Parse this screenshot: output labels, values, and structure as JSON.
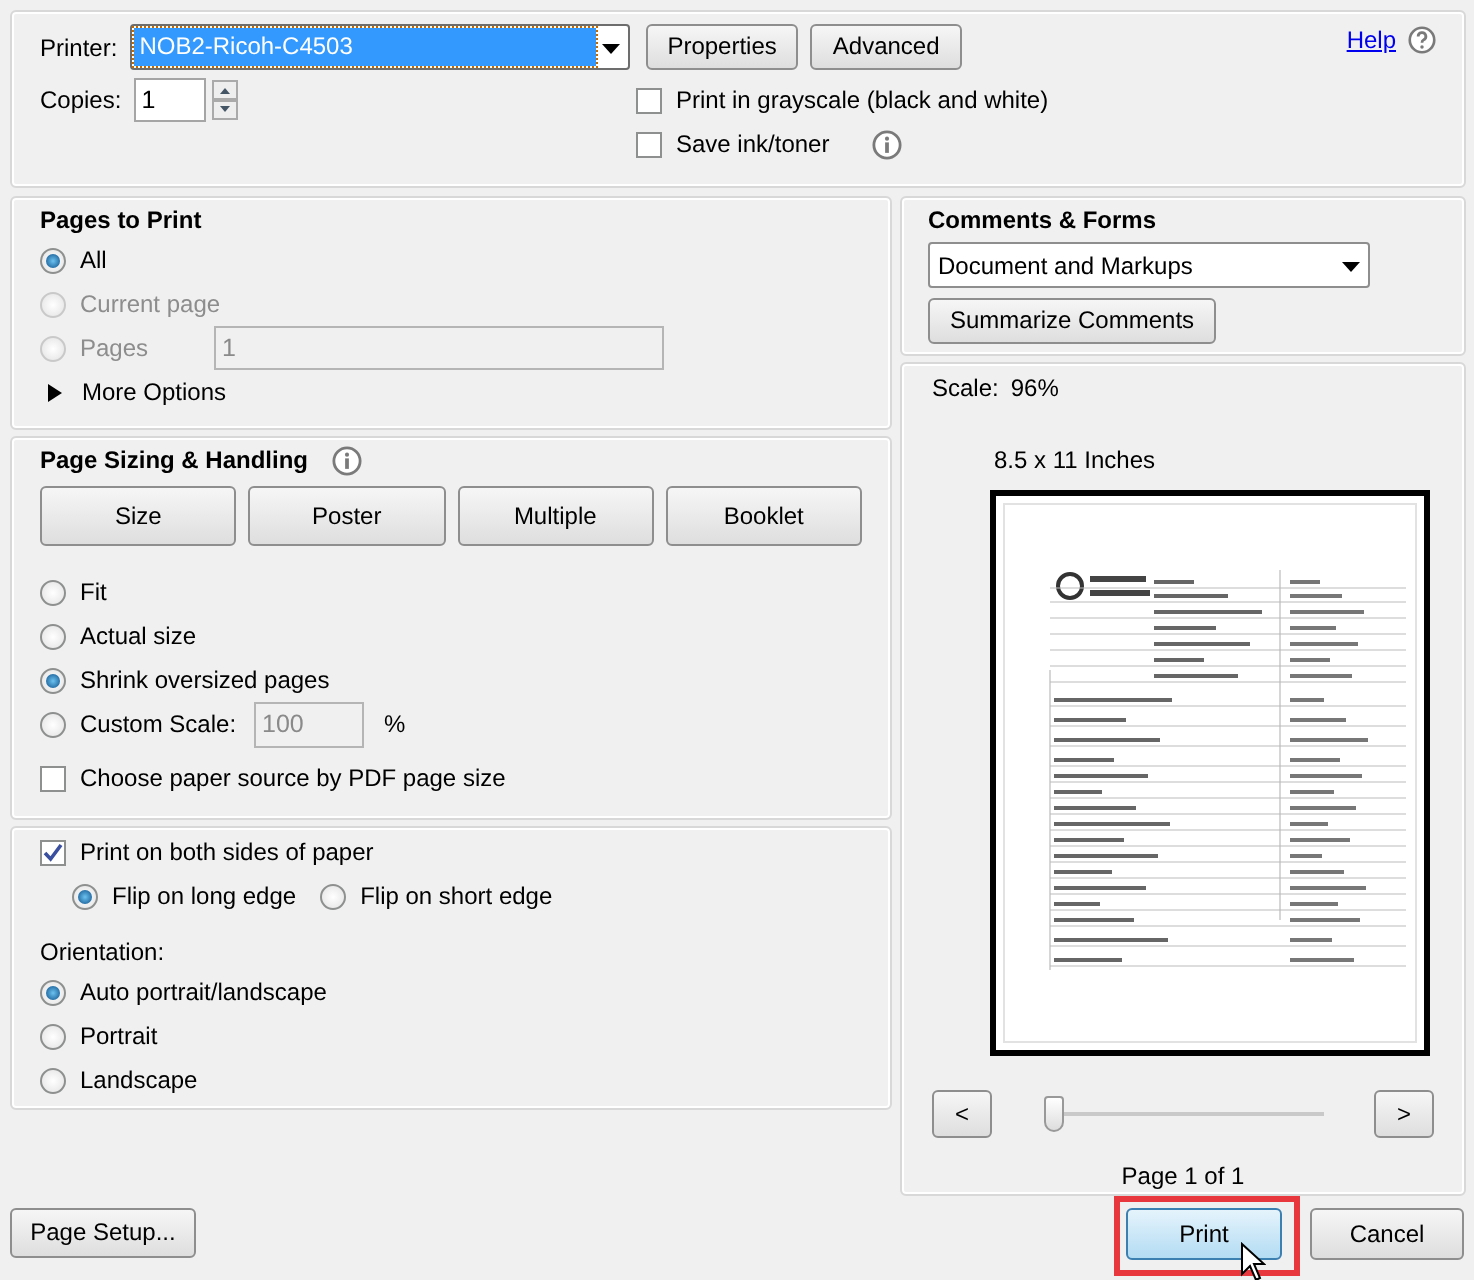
{
  "printer": {
    "label": "Printer:",
    "value": "NOB2-Ricoh-C4503"
  },
  "top_buttons": [
    {
      "label": "Properties"
    },
    {
      "label": "Advanced"
    }
  ],
  "help": {
    "label": "Help"
  },
  "copies": {
    "label": "Copies:",
    "value": "1"
  },
  "print_options": [
    {
      "label": "Print in grayscale (black and white)",
      "checked": false,
      "info": false
    },
    {
      "label": "Save ink/toner",
      "checked": false,
      "info": true
    }
  ],
  "pages_to_print": {
    "title": "Pages to Print",
    "options": [
      {
        "label": "All",
        "selected": true,
        "disabled": false
      },
      {
        "label": "Current page",
        "selected": false,
        "disabled": true
      },
      {
        "label": "Pages",
        "selected": false,
        "disabled": true,
        "value": "1"
      }
    ],
    "more_options": {
      "label": "More Options",
      "expanded": false
    }
  },
  "page_sizing": {
    "title": "Page Sizing & Handling",
    "modes": [
      {
        "label": "Size"
      },
      {
        "label": "Poster"
      },
      {
        "label": "Multiple"
      },
      {
        "label": "Booklet"
      }
    ],
    "options": [
      {
        "label": "Fit",
        "selected": false
      },
      {
        "label": "Actual size",
        "selected": false
      },
      {
        "label": "Shrink oversized pages",
        "selected": true
      },
      {
        "label": "Custom Scale:",
        "selected": false,
        "value": "100",
        "unit": "%"
      }
    ],
    "paper_source": {
      "label": "Choose paper source by PDF page size",
      "checked": false
    }
  },
  "duplex": {
    "label": "Print on both sides of paper",
    "checked": true,
    "options": [
      {
        "label": "Flip on long edge",
        "selected": true
      },
      {
        "label": "Flip on short edge",
        "selected": false
      }
    ]
  },
  "orientation": {
    "title": "Orientation:",
    "options": [
      {
        "label": "Auto portrait/landscape",
        "selected": true
      },
      {
        "label": "Portrait",
        "selected": false
      },
      {
        "label": "Landscape",
        "selected": false
      }
    ]
  },
  "comments_forms": {
    "title": "Comments & Forms",
    "value": "Document and Markups",
    "button": "Summarize Comments"
  },
  "preview": {
    "scale_label": "Scale:",
    "scale_value": "96%",
    "paper": "8.5 x 11 Inches",
    "prev": "<",
    "next": ">",
    "page_slider": {
      "level": 0
    },
    "page_label": "Page 1 of 1"
  },
  "footer": {
    "page_setup": "Page Setup...",
    "print": {
      "label": "Print",
      "highlighted": true
    },
    "cancel": "Cancel"
  }
}
